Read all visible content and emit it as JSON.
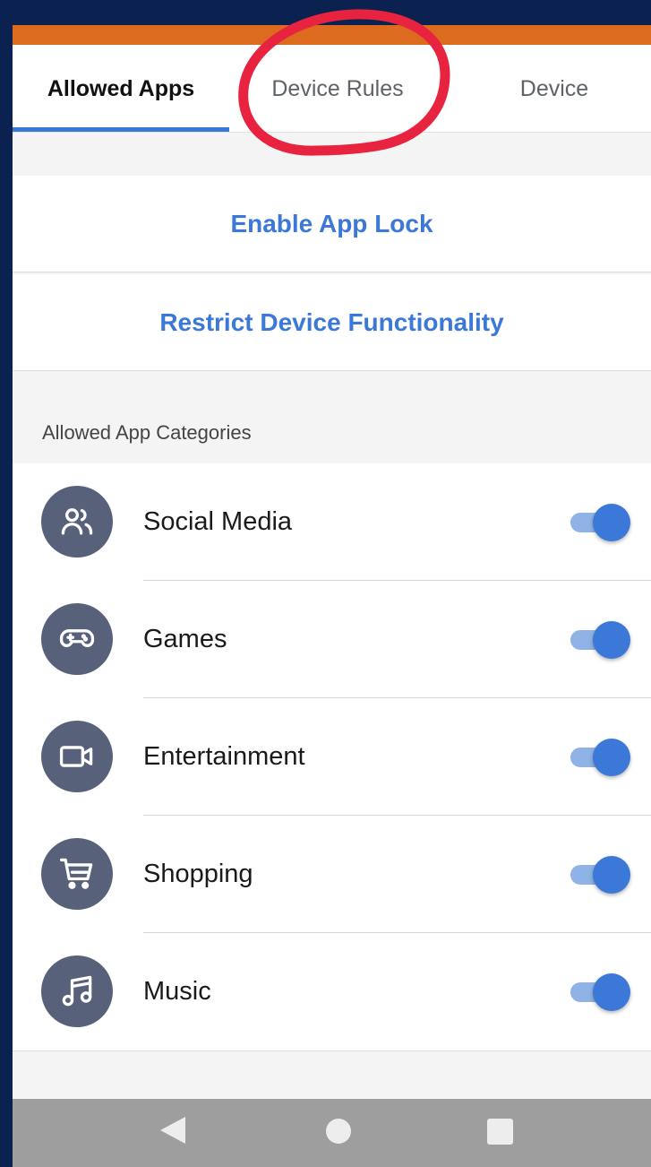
{
  "tabs": [
    {
      "label": "Allowed Apps",
      "active": true
    },
    {
      "label": "Device Rules",
      "active": false
    },
    {
      "label": "Device",
      "active": false
    }
  ],
  "actions": {
    "enable_app_lock": "Enable App Lock",
    "restrict_device": "Restrict Device Functionality"
  },
  "section_label": "Allowed App Categories",
  "categories": [
    {
      "label": "Social Media",
      "icon": "users-icon",
      "enabled": true
    },
    {
      "label": "Games",
      "icon": "gamepad-icon",
      "enabled": true
    },
    {
      "label": "Entertainment",
      "icon": "video-camera-icon",
      "enabled": true
    },
    {
      "label": "Shopping",
      "icon": "shopping-cart-icon",
      "enabled": true
    },
    {
      "label": "Music",
      "icon": "music-note-icon",
      "enabled": true
    }
  ],
  "colors": {
    "accent": "#3b78d8",
    "header_bar": "#dc6a1f",
    "frame": "#0b2150",
    "annotation": "#e8233f"
  }
}
